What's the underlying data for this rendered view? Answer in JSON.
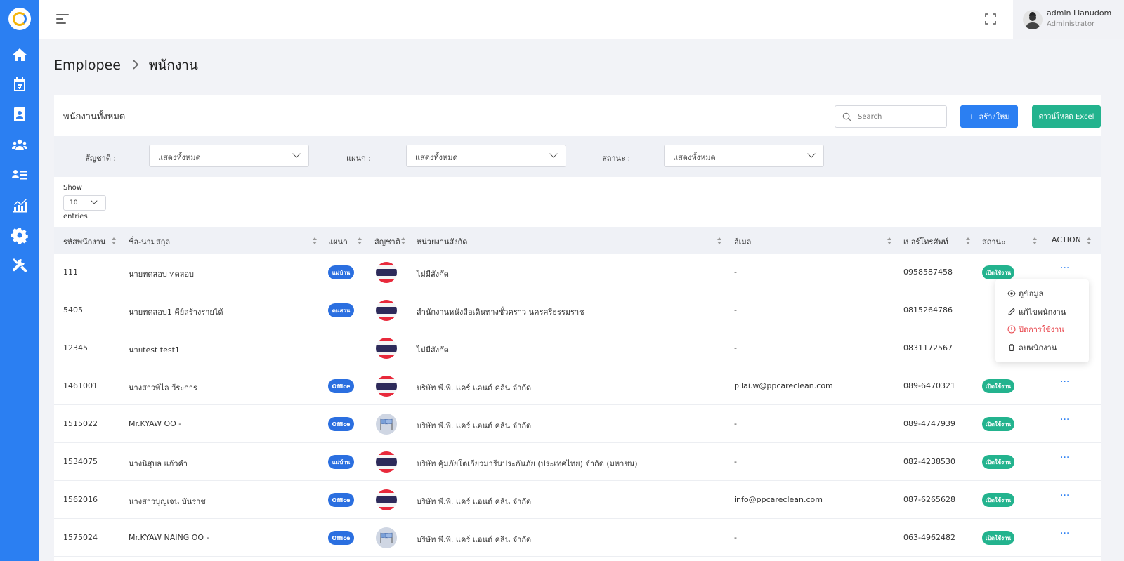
{
  "header": {
    "user_name": "admin Lianudom",
    "user_role": "Administrator"
  },
  "breadcrumb": {
    "parent": "Emplopee",
    "current": "พนักงาน"
  },
  "card": {
    "title": "พนักงานทั้งหมด",
    "search_placeholder": "Search",
    "create_label": "สร้างใหม่",
    "create_icon": "+",
    "excel_label": "ดาวน์โหลด Excel"
  },
  "filters": {
    "nationality_label": "สัญชาติ :",
    "nationality_value": "แสดงทั้งหมด",
    "department_label": "แผนก :",
    "department_value": "แสดงทั้งหมด",
    "status_label": "สถานะ :",
    "status_value": "แสดงทั้งหมด"
  },
  "length": {
    "show_label": "Show",
    "value": "10",
    "entries_label": "entries"
  },
  "table": {
    "columns": [
      "รหัสพนักงาน",
      "ชื่อ-นามสกุล",
      "แผนก",
      "สัญชาติ",
      "หน่วยงานสังกัด",
      "อีเมล",
      "เบอร์โทรศัพท์",
      "สถานะ",
      "ACTION"
    ],
    "rows": [
      {
        "id": "111",
        "name": "นายทดสอบ ทดสอบ",
        "dept": "แม่บ้าน",
        "flag": "thailand-flag",
        "unit": "ไม่มีสังกัด",
        "email": "-",
        "phone": "0958587458",
        "status": "เปิดใช้งาน",
        "action": "···"
      },
      {
        "id": "5405",
        "name": "นายทดสอบ1 คีย์สร้างรายได้",
        "dept": "คนสวน",
        "flag": "thailand-flag",
        "unit": "สำนักงานหนังสือเดินทางชั่วคราว นครศรีธรรมราช",
        "email": "-",
        "phone": "0815264786",
        "status": "",
        "action": ""
      },
      {
        "id": "12345",
        "name": "นายtest test1",
        "dept": "",
        "flag": "thailand-flag",
        "unit": "ไม่มีสังกัด",
        "email": "-",
        "phone": "0831172567",
        "status": "",
        "action": ""
      },
      {
        "id": "1461001",
        "name": "นางสาวพิไล วีระการ",
        "dept": "Office",
        "flag": "thailand-flag",
        "unit": "บริษัท พี.พี. แคร์ แอนด์ คลีน จำกัด",
        "email": "pilai.w@ppcareclean.com",
        "phone": "089-6470321",
        "status": "เปิดใช้งาน",
        "action": "···"
      },
      {
        "id": "1515022",
        "name": "Mr.KYAW OO -",
        "dept": "Office",
        "flag": "myanmar-flag",
        "unit": "บริษัท พี.พี. แคร์ แอนด์ คลีน จำกัด",
        "email": "-",
        "phone": "089-4747939",
        "status": "เปิดใช้งาน",
        "action": "···"
      },
      {
        "id": "1534075",
        "name": "นางนิสุบล แก้วคำ",
        "dept": "แม่บ้าน",
        "flag": "thailand-flag",
        "unit": "บริษัท คุ้มภัยโตเกียวมารีนประกันภัย (ประเทศไทย) จำกัด (มหาชน)",
        "email": "-",
        "phone": "082-4238530",
        "status": "เปิดใช้งาน",
        "action": "···"
      },
      {
        "id": "1562016",
        "name": "นางสาวบุญเจน บันราช",
        "dept": "Office",
        "flag": "thailand-flag",
        "unit": "บริษัท พี.พี. แคร์ แอนด์ คลีน จำกัด",
        "email": "info@ppcareclean.com",
        "phone": "087-6265628",
        "status": "เปิดใช้งาน",
        "action": "···"
      },
      {
        "id": "1575024",
        "name": "Mr.KYAW NAING OO -",
        "dept": "Office",
        "flag": "myanmar-flag",
        "unit": "บริษัท พี.พี. แคร์ แอนด์ คลีน จำกัด",
        "email": "-",
        "phone": "063-4962482",
        "status": "เปิดใช้งาน",
        "action": "···"
      }
    ]
  },
  "dropdown": {
    "view": "ดูข้อมูล",
    "edit": "แก้ไขพนักงาน",
    "disable": "ปิดการใช้งาน",
    "delete": "ลบพนักงาน"
  },
  "colors": {
    "primary": "#2b7ff2",
    "success": "#23b38e",
    "danger": "#e8434a",
    "badge_dept": "#2b6fe0"
  }
}
